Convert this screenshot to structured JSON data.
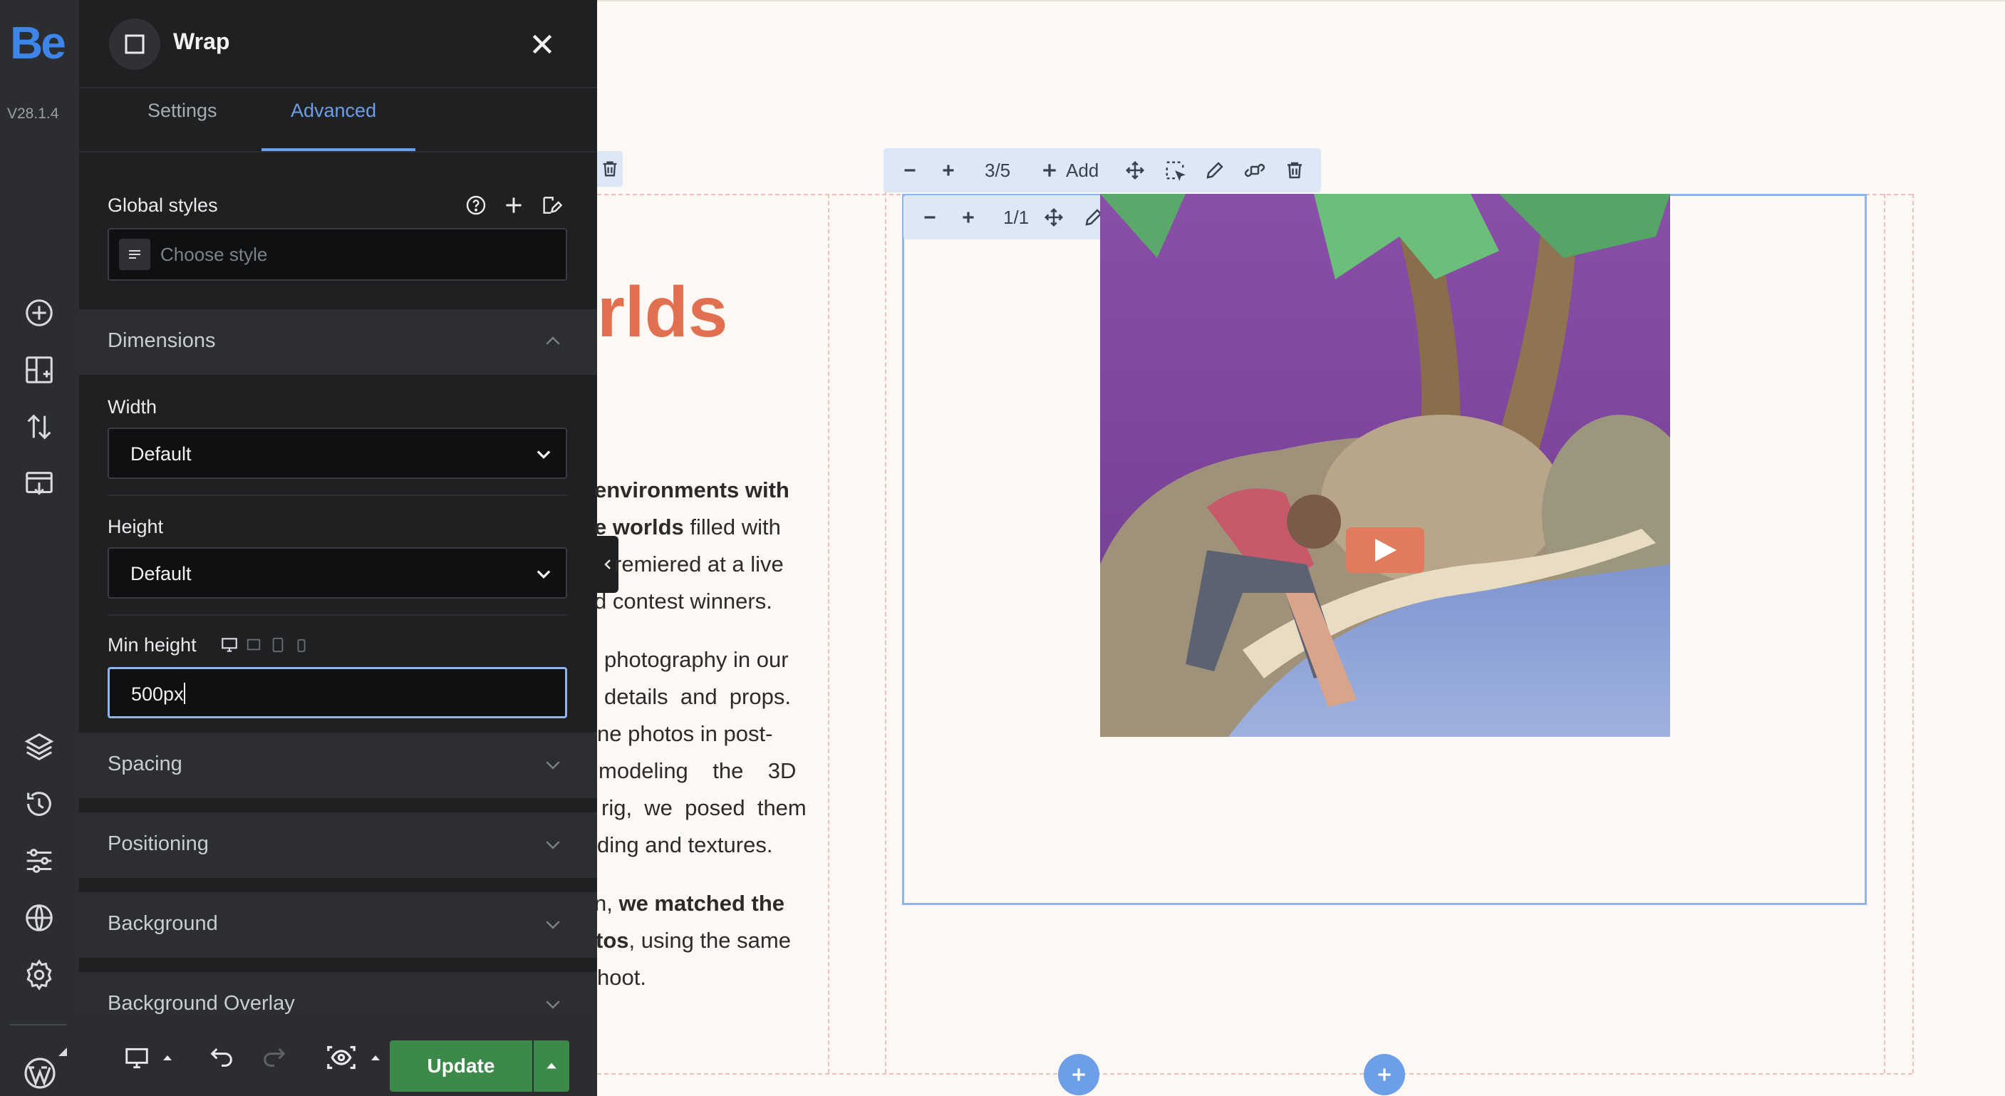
{
  "app": {
    "logo": "Be",
    "version": "V28.1.4"
  },
  "panel": {
    "title": "Wrap",
    "tabs": [
      {
        "label": "Settings",
        "active": false
      },
      {
        "label": "Advanced",
        "active": true
      }
    ],
    "global_styles": {
      "label": "Global styles",
      "placeholder": "Choose style"
    },
    "dimensions": {
      "label": "Dimensions",
      "width": {
        "label": "Width",
        "value": "Default"
      },
      "height": {
        "label": "Height",
        "value": "Default"
      },
      "min_height": {
        "label": "Min height",
        "value": "500px"
      }
    },
    "sections": [
      "Spacing",
      "Positioning",
      "Background",
      "Background Overlay"
    ],
    "footer": {
      "update_label": "Update"
    }
  },
  "canvas": {
    "heading_fragment": "rlds",
    "paragraph1": [
      {
        "text": "environments with",
        "bold": true
      },
      {
        "text": "",
        "bold_part": "e worlds",
        "rest": " filled with"
      },
      {
        "text": "remiered at a live"
      },
      {
        "text": "d contest winners."
      }
    ],
    "p1_line2_bold": "e worlds",
    "p1_line2_rest": " filled with",
    "paragraph2": [
      "photography in our",
      "details  and  props.",
      "ne photos in post-",
      "modeling    the    3D",
      "rig,  we  posed  them",
      "ding and textures."
    ],
    "p3_line1_a": "n, ",
    "p3_line1_b": "we matched the",
    "p3_line2_a": "tos",
    "p3_line2_b": ", using the same",
    "p3_line3": "hoot.",
    "toolbar_outer": {
      "counter": "3/5",
      "add_label": "Add"
    },
    "toolbar_inner": {
      "counter": "1/1"
    }
  },
  "colors": {
    "accent": "#6d9fe8",
    "heading": "#e0704f",
    "update_button": "#3c8a4a",
    "play_button": "#e27b5e"
  }
}
